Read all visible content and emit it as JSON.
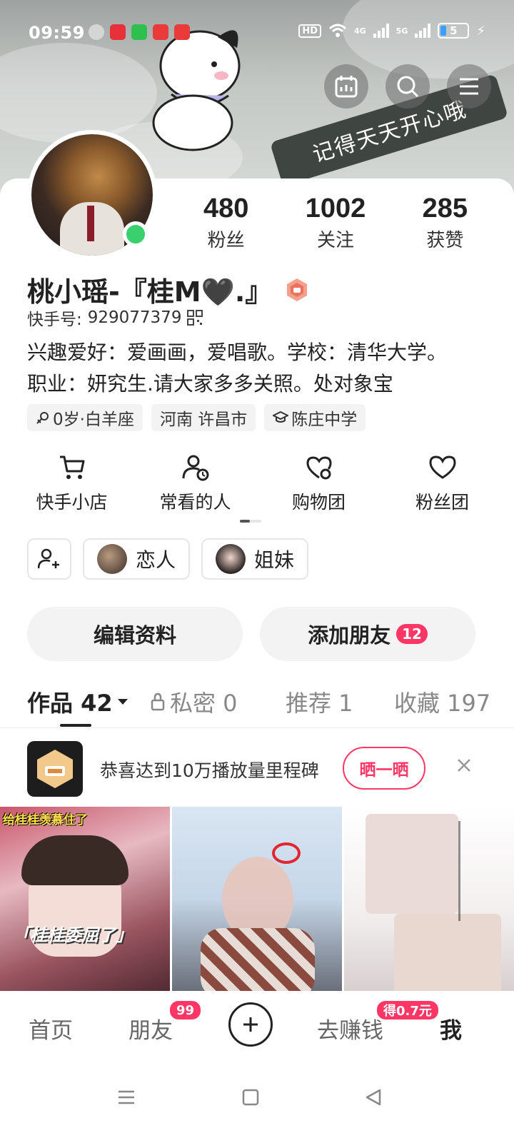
{
  "status_bar": {
    "time": "09:59",
    "battery": "5",
    "network_a": "4G",
    "network_b": "5G"
  },
  "banner": {
    "slogan": "记得天天开心哦"
  },
  "profile": {
    "stats": [
      {
        "value": "480",
        "label": "粉丝"
      },
      {
        "value": "1002",
        "label": "关注"
      },
      {
        "value": "285",
        "label": "获赞"
      }
    ],
    "name": "桃小瑶-『桂M🖤.』",
    "uid_label": "快手号:",
    "uid": "929077379",
    "bio_line1": "兴趣爱好：爱画画，爱唱歌。学校：清华大学。",
    "bio_line2": "职业：妍究生.请大家多多关照。处对象宝",
    "tags": [
      "0岁·白羊座",
      "河南 许昌市",
      "陈庄中学"
    ]
  },
  "shortcuts": [
    {
      "label": "快手小店",
      "icon": "cart-icon"
    },
    {
      "label": "常看的人",
      "icon": "user-clock-icon"
    },
    {
      "label": "购物团",
      "icon": "heart-chat-icon"
    },
    {
      "label": "粉丝团",
      "icon": "heart-icon"
    }
  ],
  "relations": [
    {
      "label": "恋人"
    },
    {
      "label": "姐妹"
    }
  ],
  "actions": {
    "edit_profile": "编辑资料",
    "add_friends": "添加朋友",
    "add_friends_count": "12"
  },
  "tabs": [
    {
      "label": "作品 42",
      "active": true
    },
    {
      "label": "私密 0",
      "active": false
    },
    {
      "label": "推荐 1",
      "active": false
    },
    {
      "label": "收藏 197",
      "active": false
    }
  ],
  "notice": {
    "text": "恭喜达到10万播放量里程碑",
    "button": "晒一晒"
  },
  "videos": [
    {
      "caption": "给桂桂羡慕住了",
      "subtitle": "「桂桂委屈了」"
    },
    {
      "caption": "",
      "subtitle": ""
    },
    {
      "caption": "",
      "subtitle": ""
    }
  ],
  "bottom_nav": {
    "home": "首页",
    "friends": "朋友",
    "friends_badge": "99",
    "earn": "去赚钱",
    "earn_badge": "得0.7元",
    "me": "我"
  },
  "colors": {
    "accent": "#fe3666",
    "online": "#3ad06d"
  }
}
